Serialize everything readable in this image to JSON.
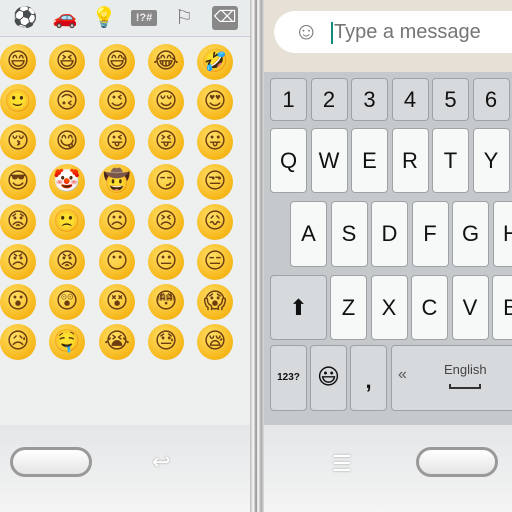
{
  "emoji_panel": {
    "category_icons": [
      "soccer-ball-icon",
      "car-icon",
      "lightbulb-icon",
      "symbols-icon",
      "flag-icon",
      "backspace-icon"
    ],
    "category_glyphs": [
      "⚽",
      "🚗",
      "💡",
      "!?#",
      "⚐",
      "⌫"
    ],
    "emojis": [
      [
        "😄",
        "😆",
        "😅",
        "😂",
        "🤣"
      ],
      [
        "🙂",
        "🙃",
        "😉",
        "😌",
        "😍"
      ],
      [
        "😚",
        "😋",
        "😜",
        "😝",
        "😛"
      ],
      [
        "😎",
        "🤡",
        "🤠",
        "😏",
        "😒"
      ],
      [
        "😟",
        "🙁",
        "☹",
        "😣",
        "😖"
      ],
      [
        "😠",
        "😡",
        "😶",
        "😐",
        "😑"
      ],
      [
        "😮",
        "😲",
        "😵",
        "😳",
        "😱"
      ],
      [
        "😥",
        "🤤",
        "😭",
        "😓",
        "😪"
      ]
    ]
  },
  "left_nav": {
    "back_glyph": "↩"
  },
  "chat": {
    "placeholder": "Type a message",
    "emoji_glyph": "☺"
  },
  "keyboard": {
    "numbers": [
      "1",
      "2",
      "3",
      "4",
      "5",
      "6"
    ],
    "row1": [
      "Q",
      "W",
      "E",
      "R",
      "T",
      "Y"
    ],
    "row2": [
      "A",
      "S",
      "D",
      "F",
      "G",
      "H"
    ],
    "row3": [
      "Z",
      "X",
      "C",
      "V",
      "B"
    ],
    "shift": "⬆",
    "sym": "123?",
    "emoji": "😃",
    "comma": ",",
    "prev": "«",
    "space_label": "English"
  },
  "right_nav": {
    "menu_glyph": "☰"
  }
}
